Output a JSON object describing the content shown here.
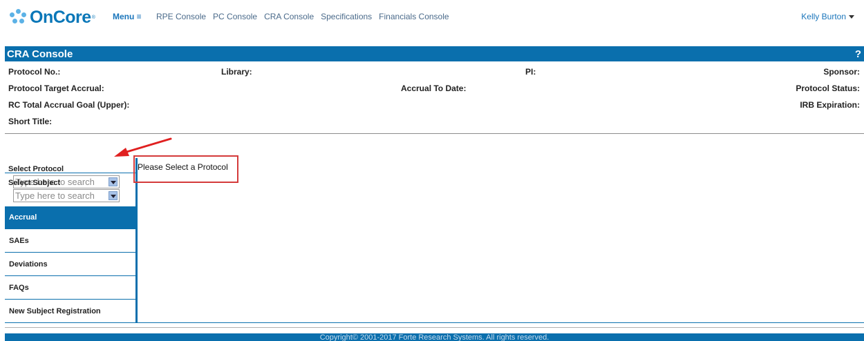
{
  "brand": {
    "name": "OnCore",
    "tm": "®",
    "accent": "#0a77b8"
  },
  "topnav": {
    "menu_label": "Menu ≡",
    "links": [
      "RPE Console",
      "PC Console",
      "CRA Console",
      "Specifications",
      "Financials Console"
    ],
    "user": "Kelly Burton"
  },
  "console": {
    "title": "CRA Console",
    "help": "?",
    "fields": {
      "protocol_no": "Protocol No.:",
      "library": "Library:",
      "pi": "PI:",
      "sponsor": "Sponsor:",
      "target_accrual": "Protocol Target Accrual:",
      "accrual_to_date": "Accrual To Date:",
      "protocol_status": "Protocol Status:",
      "rc_total": "RC Total Accrual Goal (Upper):",
      "irb_expiration": "IRB Expiration:",
      "short_title": "Short Title:"
    }
  },
  "sidebar": {
    "select_protocol": {
      "label": "Select Protocol",
      "placeholder": "Type here to search"
    },
    "select_subject": {
      "label": "Select Subject",
      "placeholder": "Type here to search"
    },
    "items": [
      {
        "label": "Accrual",
        "active": true
      },
      {
        "label": "SAEs",
        "active": false
      },
      {
        "label": "Deviations",
        "active": false
      },
      {
        "label": "FAQs",
        "active": false
      },
      {
        "label": "New Subject Registration",
        "active": false
      }
    ]
  },
  "main": {
    "message": "Please Select a Protocol"
  },
  "footer": {
    "text": "Copyright© 2001-2017 Forte Research Systems. All rights reserved."
  },
  "colors": {
    "primary": "#0a6fad",
    "highlight_border": "#d43a3a",
    "arrow": "#e02020"
  }
}
